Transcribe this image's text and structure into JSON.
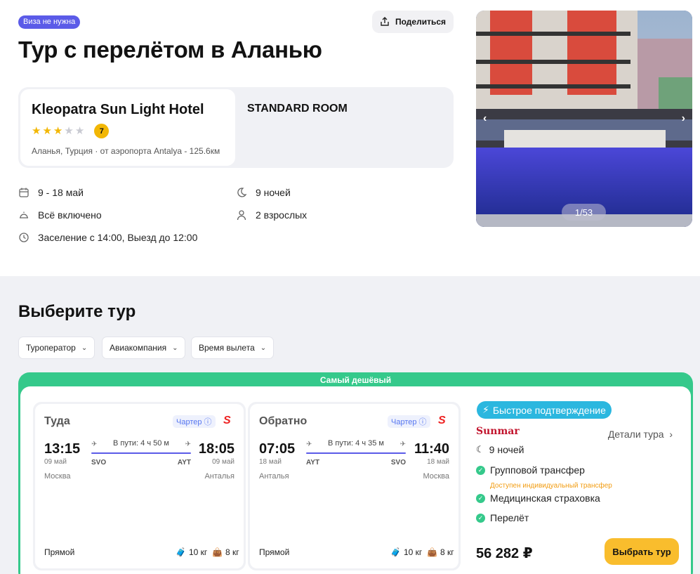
{
  "header": {
    "visa_badge": "Виза не нужна",
    "share_label": "Поделиться",
    "title": "Тур с перелётом в Аланью"
  },
  "hotel": {
    "name": "Kleopatra Sun Light Hotel",
    "stars": 3,
    "max_stars": 5,
    "rating": "7",
    "location": "Аланья, Турция · от аэропорта Antalya - 125.6км",
    "room": "STANDARD ROOM"
  },
  "trip_info": {
    "dates": "9 - 18 май",
    "nights": "9 ночей",
    "meal": "Всё включено",
    "guests": "2 взрослых",
    "checkin": "Заселение с 14:00, Выезд до 12:00"
  },
  "gallery": {
    "counter": "1/53"
  },
  "tours": {
    "title": "Выберите тур",
    "filters": [
      "Туроператор",
      "Авиакомпания",
      "Время вылета"
    ],
    "cheapest_label": "Самый дешёвый",
    "outbound": {
      "label": "Туда",
      "charter": "Чартер",
      "dep_time": "13:15",
      "dep_date": "09 май",
      "dep_city": "Москва",
      "dep_code": "SVO",
      "duration": "В пути: 4 ч 50 м",
      "arr_time": "18:05",
      "arr_date": "09 май",
      "arr_city": "Анталья",
      "arr_code": "AYT",
      "type": "Прямой",
      "hand_luggage": "10 кг",
      "luggage": "8 кг"
    },
    "return": {
      "label": "Обратно",
      "charter": "Чартер",
      "dep_time": "07:05",
      "dep_date": "18 май",
      "dep_city": "Анталья",
      "dep_code": "AYT",
      "duration": "В пути: 4 ч 35 м",
      "arr_time": "11:40",
      "arr_date": "18 май",
      "arr_city": "Москва",
      "arr_code": "SVO",
      "type": "Прямой",
      "hand_luggage": "10 кг",
      "luggage": "8 кг"
    },
    "offer": {
      "fast_confirm": "Быстрое подтверждение",
      "operator": "Sunmar",
      "details": "Детали тура",
      "nights": "9 ночей",
      "transfer": "Групповой трансфер",
      "transfer_note": "Доступен индивидуальный трансфер",
      "insurance": "Медицинская страховка",
      "flight": "Перелёт",
      "price": "56 282 ₽",
      "choose": "Выбрать тур"
    }
  },
  "colors": {
    "accent": "#5b5be8",
    "green": "#35c98b",
    "star": "#f2b705",
    "button": "#f9bd2d",
    "fast": "#2bb7df"
  }
}
